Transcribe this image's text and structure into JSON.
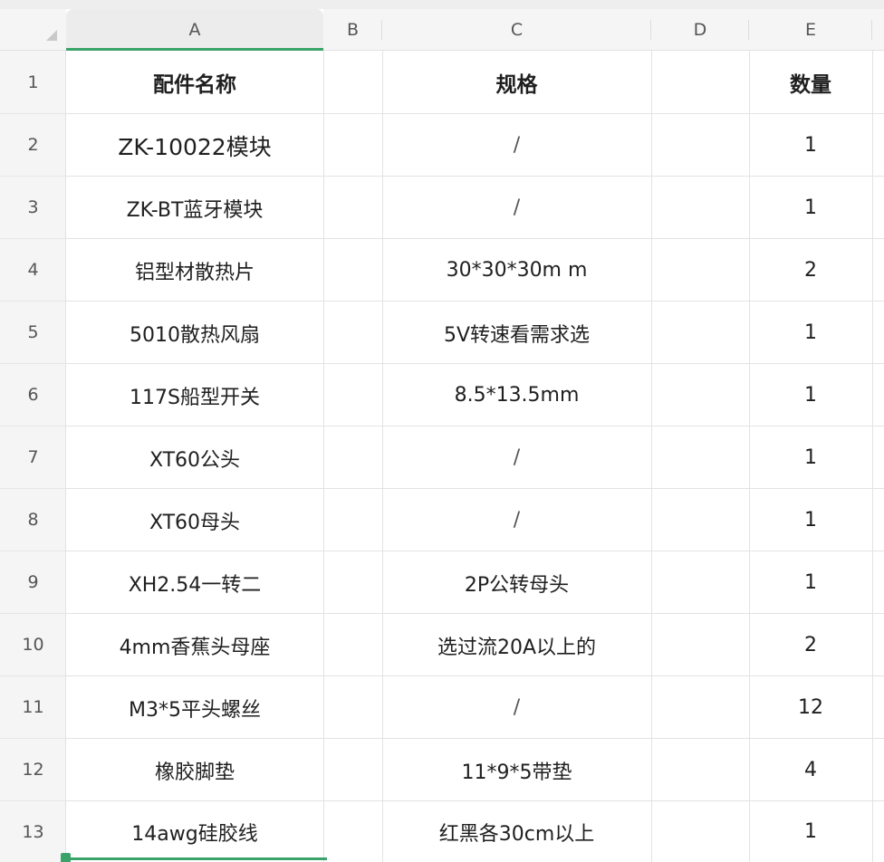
{
  "columns": [
    "A",
    "B",
    "C",
    "D",
    "E"
  ],
  "row_numbers": [
    "1",
    "2",
    "3",
    "4",
    "5",
    "6",
    "7",
    "8",
    "9",
    "10",
    "11",
    "12",
    "13"
  ],
  "header": {
    "part_name": "配件名称",
    "spec": "规格",
    "quantity": "数量"
  },
  "rows": [
    {
      "name": "ZK-10022模块",
      "spec": "/",
      "qty": "1"
    },
    {
      "name": "ZK-BT蓝牙模块",
      "spec": "/",
      "qty": "1"
    },
    {
      "name": "铝型材散热片",
      "spec": "30*30*30m m",
      "qty": "2"
    },
    {
      "name": "5010散热风扇",
      "spec": "5V转速看需求选",
      "qty": "1"
    },
    {
      "name": "117S船型开关",
      "spec": "8.5*13.5mm",
      "qty": "1"
    },
    {
      "name": "XT60公头",
      "spec": "/",
      "qty": "1"
    },
    {
      "name": "XT60母头",
      "spec": "/",
      "qty": "1"
    },
    {
      "name": "XH2.54一转二",
      "spec": "2P公转母头",
      "qty": "1"
    },
    {
      "name": "4mm香蕉头母座",
      "spec": "选过流20A以上的",
      "qty": "2"
    },
    {
      "name": "M3*5平头螺丝",
      "spec": "/",
      "qty": "12"
    },
    {
      "name": "橡胶脚垫",
      "spec": "11*9*5带垫",
      "qty": "4"
    },
    {
      "name": "14awg硅胶线",
      "spec": "红黑各30cm以上",
      "qty": "1"
    }
  ],
  "colors": {
    "selection_accent": "#3aa36a",
    "header_bg": "#f5f5f5",
    "gridline": "#e3e3e3"
  }
}
